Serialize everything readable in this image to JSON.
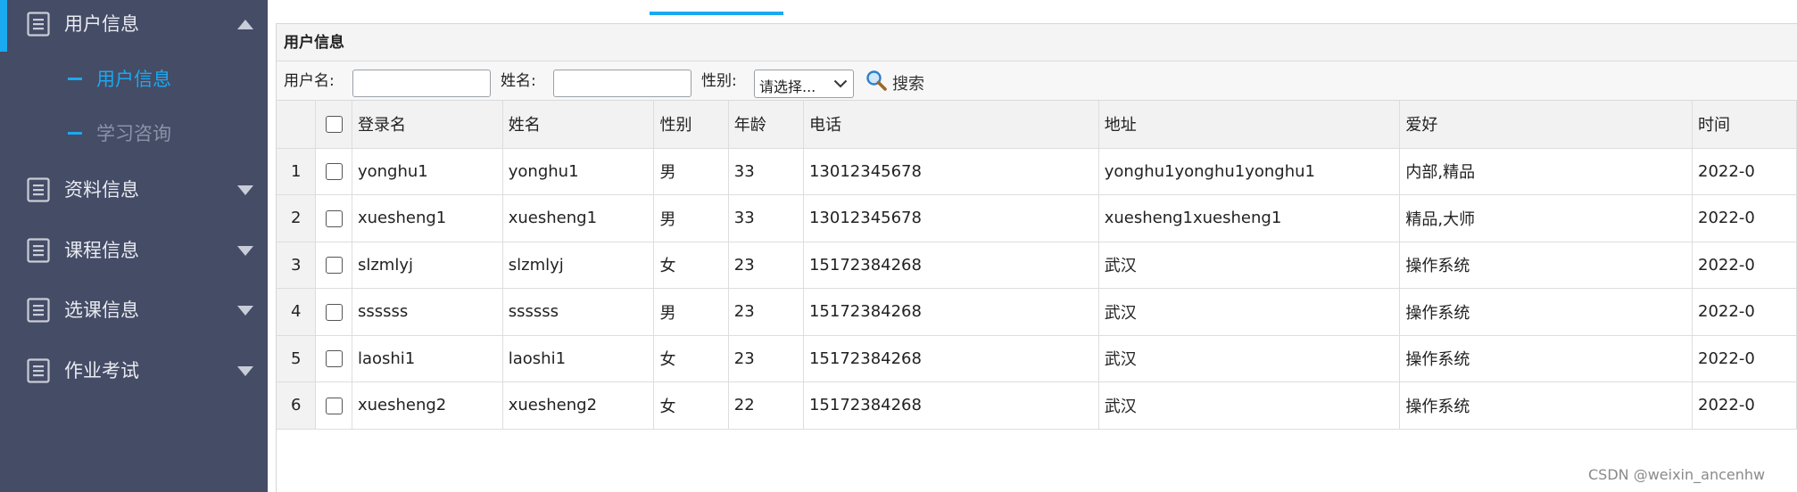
{
  "sidebar": {
    "groups": [
      {
        "label": "用户信息",
        "expanded": true,
        "icon": "document-icon",
        "children": [
          {
            "label": "用户信息",
            "active": true
          },
          {
            "label": "学习咨询",
            "active": false
          }
        ]
      },
      {
        "label": "资料信息",
        "expanded": false,
        "icon": "document-icon"
      },
      {
        "label": "课程信息",
        "expanded": false,
        "icon": "document-icon"
      },
      {
        "label": "选课信息",
        "expanded": false,
        "icon": "document-icon"
      },
      {
        "label": "作业考试",
        "expanded": false,
        "icon": "document-icon"
      }
    ]
  },
  "panel": {
    "title": "用户信息"
  },
  "toolbar": {
    "username_label": "用户名:",
    "username_value": "",
    "name_label": "姓名:",
    "name_value": "",
    "gender_label": "性别:",
    "gender_selected": "请选择...",
    "search_label": "搜索",
    "search_icon": "magnifier-icon"
  },
  "table": {
    "columns": [
      "登录名",
      "姓名",
      "性别",
      "年龄",
      "电话",
      "地址",
      "爱好",
      "时间"
    ],
    "rows": [
      {
        "num": "1",
        "cells": [
          "yonghu1",
          "yonghu1",
          "男",
          "33",
          "13012345678",
          "yonghu1yonghu1yonghu1",
          "内部,精品",
          "2022-0"
        ]
      },
      {
        "num": "2",
        "cells": [
          "xuesheng1",
          "xuesheng1",
          "男",
          "33",
          "13012345678",
          "xuesheng1xuesheng1",
          "精品,大师",
          "2022-0"
        ]
      },
      {
        "num": "3",
        "cells": [
          "slzmlyj",
          "slzmlyj",
          "女",
          "23",
          "15172384268",
          "武汉",
          "操作系统",
          "2022-0"
        ]
      },
      {
        "num": "4",
        "cells": [
          "ssssss",
          "ssssss",
          "男",
          "23",
          "15172384268",
          "武汉",
          "操作系统",
          "2022-0"
        ]
      },
      {
        "num": "5",
        "cells": [
          "laoshi1",
          "laoshi1",
          "女",
          "23",
          "15172384268",
          "武汉",
          "操作系统",
          "2022-0"
        ]
      },
      {
        "num": "6",
        "cells": [
          "xuesheng2",
          "xuesheng2",
          "女",
          "22",
          "15172384268",
          "武汉",
          "操作系统",
          "2022-0"
        ]
      }
    ]
  },
  "watermark": "CSDN @weixin_ancenhw",
  "colors": {
    "sidebar_bg": "#454c66",
    "accent": "#1ba9f0",
    "inactive_sub": "#8b93a8"
  }
}
